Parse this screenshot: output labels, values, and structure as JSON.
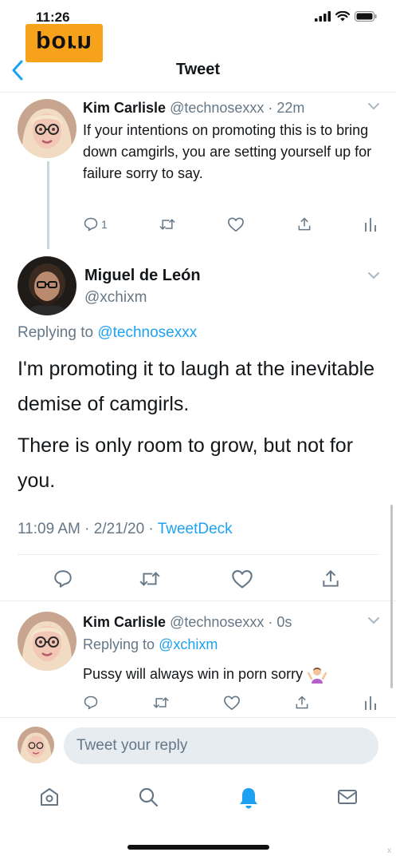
{
  "status": {
    "time": "11:26"
  },
  "watermark": "porn",
  "nav": {
    "title": "Tweet"
  },
  "tweets": [
    {
      "name": "Kim Carlisle",
      "handle": "@technosexxx",
      "time": "· 22m",
      "text": "If your intentions on promoting this is to bring down camgirls, you are setting yourself up for failure sorry to say.",
      "reply_count": "1"
    },
    {
      "name": "Miguel de León",
      "handle": "@xchixm",
      "replying_prefix": "Replying to",
      "replying_to": "@technosexxx",
      "text1": "I'm promoting it to laugh at the inevitable demise of camgirls.",
      "text2": "There is only room to grow, but not for you.",
      "meta_time": "11:09 AM · 2/21/20 ·",
      "meta_source": "TweetDeck"
    },
    {
      "name": "Kim Carlisle",
      "handle": "@technosexxx",
      "time": "· 0s",
      "replying_prefix": "Replying to",
      "replying_to": "@xchixm",
      "text": "Pussy will always win in porn sorry"
    }
  ],
  "compose": {
    "placeholder": "Tweet your reply"
  },
  "tabs": [
    "home-icon",
    "search-icon",
    "notifications-icon",
    "messages-icon"
  ],
  "colors": {
    "accent": "#1da1f2",
    "secondary": "#657786",
    "watermark_bg": "#f7a21b"
  }
}
